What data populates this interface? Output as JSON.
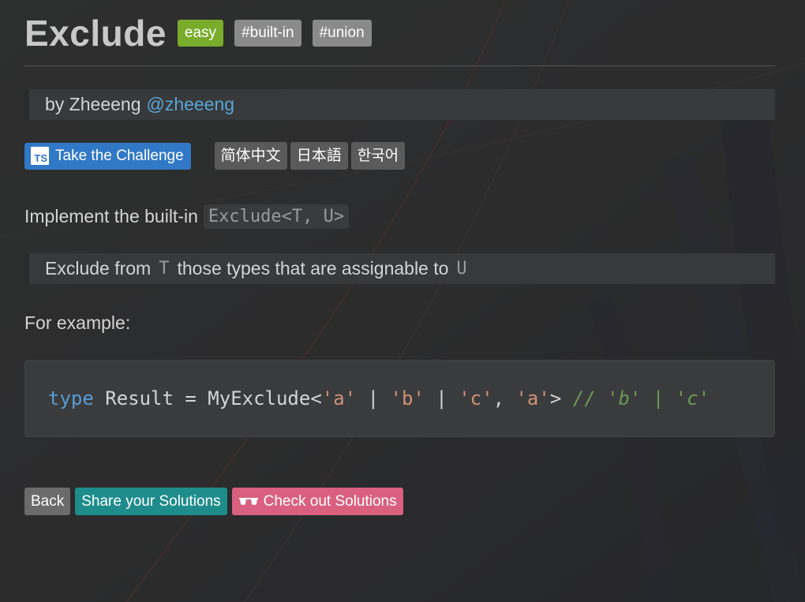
{
  "header": {
    "title": "Exclude",
    "difficulty": "easy",
    "tags": [
      "#built-in",
      "#union"
    ]
  },
  "author": {
    "prefix": "by Zheeeng",
    "handle": "@zheeeng"
  },
  "challenge": {
    "take_label": "Take the Challenge",
    "ts_icon_text": "TS",
    "languages": [
      "简体中文",
      "日本語",
      "한국어"
    ]
  },
  "description": {
    "intro": "Implement the built-in",
    "intro_code": "Exclude<T, U>",
    "quote_prefix": "Exclude from",
    "quote_t": "T",
    "quote_middle": "those types that are assignable to",
    "quote_u": "U",
    "example_label": "For example:"
  },
  "code": {
    "tokens": {
      "kw": "type",
      "name": " Result = MyExclude<",
      "s1": "'a'",
      "p1": " | ",
      "s2": "'b'",
      "p2": " | ",
      "s3": "'c'",
      "p3": ", ",
      "s4": "'a'",
      "p4": "> ",
      "comment": "// 'b' | 'c'"
    }
  },
  "footer": {
    "back_label": "Back",
    "share_label": "Share your Solutions",
    "check_label": "Check out Solutions",
    "check_icon": "glasses-icon"
  },
  "colors": {
    "difficulty_easy": "#7aac2c",
    "tag": "#8a8a8a",
    "take_challenge": "#3178c6",
    "share": "#1f8c8c",
    "check": "#d9607e",
    "link": "#58a6d6"
  }
}
